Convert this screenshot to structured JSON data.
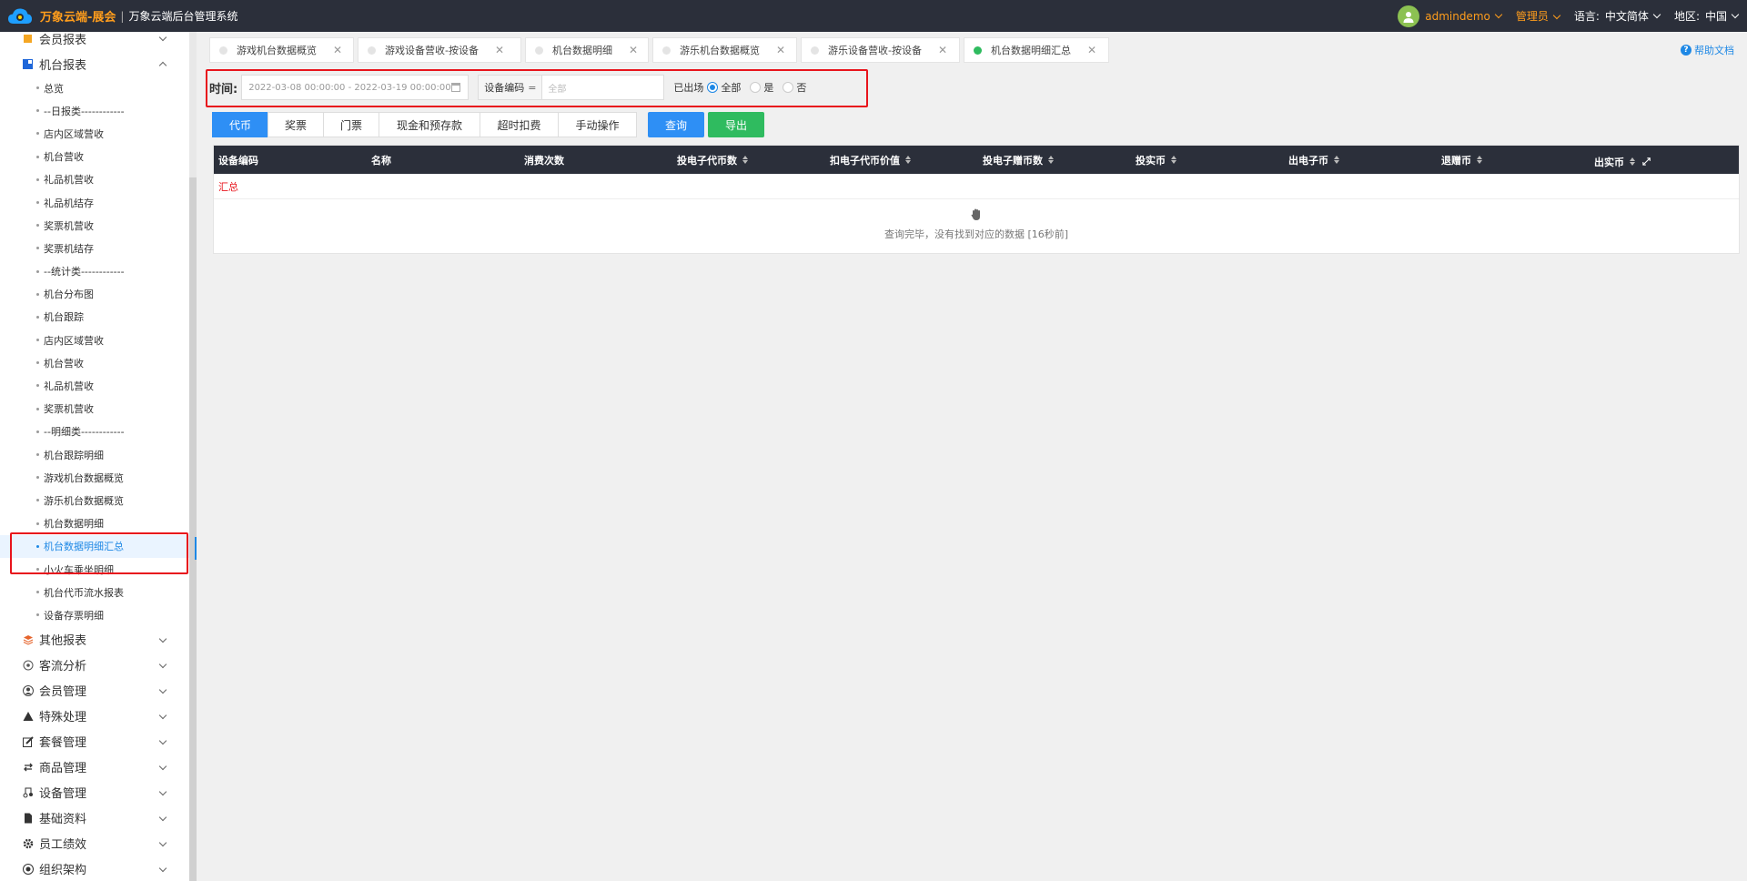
{
  "header": {
    "brand": "万象云端-展会",
    "separator": "|",
    "subtitle": "万象云端后台管理系统",
    "username": "admindemo",
    "role": "管理员",
    "language_label": "语言:",
    "language_value": "中文简体",
    "region_label": "地区:",
    "region_value": "中国"
  },
  "sidebar": {
    "groups_top": [
      {
        "label": "会员报表",
        "icon": "member-report-icon"
      },
      {
        "label": "机台报表",
        "icon": "machine-report-icon"
      }
    ],
    "items": [
      "总览",
      "--日报类------------",
      "店内区域营收",
      "机台营收",
      "礼品机营收",
      "礼品机结存",
      "奖票机营收",
      "奖票机结存",
      "--统计类------------",
      "机台分布图",
      "机台跟踪",
      "店内区域营收",
      "机台营收",
      "礼品机营收",
      "奖票机营收",
      "--明细类------------",
      "机台跟踪明细",
      "游戏机台数据概览",
      "游乐机台数据概览",
      "机台数据明细",
      "机台数据明细汇总",
      "小火车乘坐明细",
      "机台代币流水报表",
      "设备存票明细"
    ],
    "active_index": 20,
    "groups_bottom": [
      {
        "label": "其他报表",
        "icon": "layers-icon"
      },
      {
        "label": "客流分析",
        "icon": "target-icon"
      },
      {
        "label": "会员管理",
        "icon": "user-icon"
      },
      {
        "label": "特殊处理",
        "icon": "warning-icon"
      },
      {
        "label": "套餐管理",
        "icon": "edit-icon"
      },
      {
        "label": "商品管理",
        "icon": "swap-icon"
      },
      {
        "label": "设备管理",
        "icon": "device-icon"
      },
      {
        "label": "基础资料",
        "icon": "file-icon"
      },
      {
        "label": "员工绩效",
        "icon": "gear-icon"
      },
      {
        "label": "组织架构",
        "icon": "org-icon"
      }
    ]
  },
  "tabs": [
    {
      "label": "游戏机台数据概览",
      "active": false
    },
    {
      "label": "游戏设备营收-按设备",
      "active": false
    },
    {
      "label": "机台数据明细",
      "active": false
    },
    {
      "label": "游乐机台数据概览",
      "active": false
    },
    {
      "label": "游乐设备营收-按设备",
      "active": false
    },
    {
      "label": "机台数据明细汇总",
      "active": true
    }
  ],
  "help_label": "帮助文档",
  "filter": {
    "time_label": "时间:",
    "date_range": "2022-03-08 00:00:00 - 2022-03-19 00:00:00",
    "device_code_label": "设备编码",
    "device_code_op": "=",
    "device_code_placeholder": "全部",
    "exited_label": "已出场",
    "radio_options": [
      "全部",
      "是",
      "否"
    ],
    "radio_selected": "全部"
  },
  "segments": [
    "代币",
    "奖票",
    "门票",
    "现金和预存款",
    "超时扣费",
    "手动操作"
  ],
  "segment_selected": "代币",
  "query_label": "查询",
  "export_label": "导出",
  "table": {
    "columns": [
      {
        "label": "设备编码",
        "sortable": false
      },
      {
        "label": "名称",
        "sortable": false
      },
      {
        "label": "消费次数",
        "sortable": false
      },
      {
        "label": "投电子代币数",
        "sortable": true
      },
      {
        "label": "扣电子代币价值",
        "sortable": true
      },
      {
        "label": "投电子赠币数",
        "sortable": true
      },
      {
        "label": "投实币",
        "sortable": true
      },
      {
        "label": "出电子币",
        "sortable": true
      },
      {
        "label": "退赠币",
        "sortable": true
      },
      {
        "label": "出实币",
        "sortable": true
      }
    ],
    "summary_label": "汇总",
    "empty_message": "查询完毕，没有找到对应的数据 [16秒前]"
  },
  "colors": {
    "topbar": "#2b2f3a",
    "brand_orange": "#ff9d1c",
    "primary_blue": "#2e8ff5",
    "success_green": "#2fbb5f",
    "highlight_red": "#e8141c"
  }
}
